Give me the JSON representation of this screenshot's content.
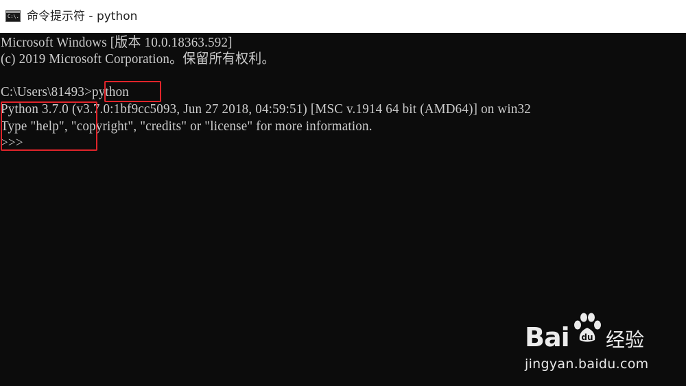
{
  "window": {
    "title": "命令提示符 - python",
    "icon_glyph": "C:\\."
  },
  "console": {
    "lines": [
      "Microsoft Windows [版本 10.0.18363.592]",
      "(c) 2019 Microsoft Corporation。保留所有权利。",
      "",
      "C:\\Users\\81493>python",
      "Python 3.7.0 (v3.7.0:1bf9cc5093, Jun 27 2018, 04:59:51) [MSC v.1914 64 bit (AMD64)] on win32",
      "Type \"help\", \"copyright\", \"credits\" or \"license\" for more information.",
      ">>>"
    ]
  },
  "watermark": {
    "logo_left": "Bai",
    "logo_right": "经验",
    "url": "jingyan.baidu.com"
  },
  "colors": {
    "console_bg": "#0c0c0c",
    "console_text": "#cccccc",
    "highlight": "#e0242a"
  }
}
